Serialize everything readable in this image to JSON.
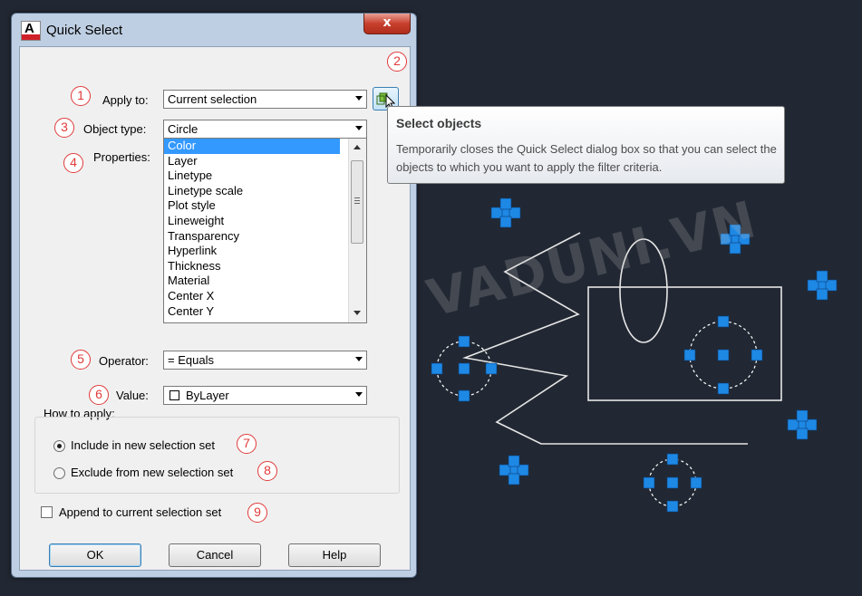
{
  "dialog": {
    "title": "Quick Select",
    "close_label": "x",
    "apply_to": {
      "label": "Apply to:",
      "value": "Current selection"
    },
    "object_type": {
      "label": "Object type:",
      "value": "Circle"
    },
    "properties": {
      "label": "Properties:",
      "items": [
        "Color",
        "Layer",
        "Linetype",
        "Linetype scale",
        "Plot style",
        "Lineweight",
        "Transparency",
        "Hyperlink",
        "Thickness",
        "Material",
        "Center X",
        "Center Y"
      ],
      "selected": "Color"
    },
    "operator": {
      "label": "Operator:",
      "value": "= Equals"
    },
    "value": {
      "label": "Value:",
      "value": "ByLayer"
    },
    "how_to_apply": {
      "label": "How to apply:",
      "include_label": "Include in new selection set",
      "exclude_label": "Exclude from new selection set",
      "selected": "include"
    },
    "append_label": "Append to current selection set",
    "append_checked": false,
    "buttons": {
      "ok": "OK",
      "cancel": "Cancel",
      "help": "Help"
    }
  },
  "badges": [
    "1",
    "2",
    "3",
    "4",
    "5",
    "6",
    "7",
    "8",
    "9"
  ],
  "tooltip": {
    "title": "Select objects",
    "description": "Temporarily closes the Quick Select dialog box so that you can select the objects to which you want to apply the filter criteria."
  },
  "watermark": "VADUNI.VN",
  "colors": {
    "canvas": "#222833",
    "grip": "#1e88e5",
    "selection_highlight": "#3399ff",
    "badge": "#e03a3a"
  },
  "icons": [
    "app-logo-icon",
    "close-icon",
    "select-objects-icon",
    "dropdown-arrow-icon",
    "color-swatch-icon"
  ]
}
